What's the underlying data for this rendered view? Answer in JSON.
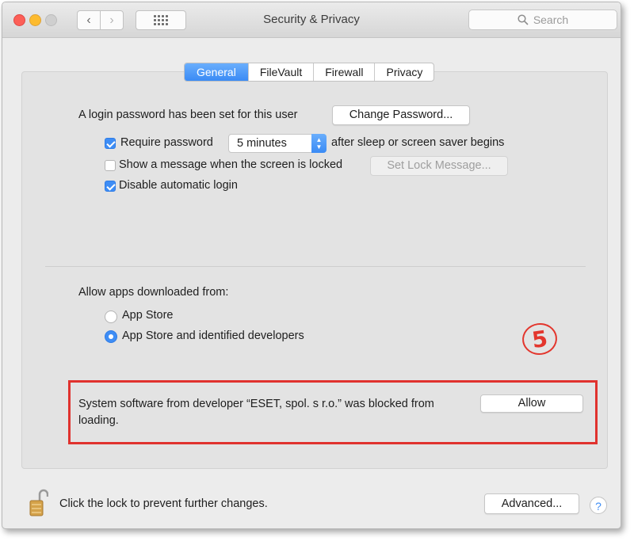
{
  "window": {
    "title": "Security & Privacy",
    "search_placeholder": "Search"
  },
  "tabs": [
    {
      "label": "General",
      "active": true
    },
    {
      "label": "FileVault",
      "active": false
    },
    {
      "label": "Firewall",
      "active": false
    },
    {
      "label": "Privacy",
      "active": false
    }
  ],
  "general": {
    "login_text": "A login password has been set for this user",
    "change_password_label": "Change Password...",
    "require_password": {
      "label": "Require password",
      "checked": true,
      "selected": "5 minutes",
      "suffix": "after sleep or screen saver begins"
    },
    "show_message": {
      "label": "Show a message when the screen is locked",
      "checked": false,
      "button_label": "Set Lock Message..."
    },
    "disable_autologin": {
      "label": "Disable automatic login",
      "checked": true
    }
  },
  "downloads": {
    "heading": "Allow apps downloaded from:",
    "options": [
      {
        "label": "App Store",
        "selected": false
      },
      {
        "label": "App Store and identified developers",
        "selected": true
      }
    ]
  },
  "blocked": {
    "message": "System software from developer “ESET, spol. s r.o.” was blocked from loading.",
    "allow_label": "Allow",
    "highlight_color": "#e0322e"
  },
  "annotation": {
    "step": "5",
    "color": "#e3362d"
  },
  "footer": {
    "lock_text": "Click the lock to prevent further changes.",
    "advanced_label": "Advanced...",
    "help_label": "?"
  },
  "colors": {
    "accent": "#3e8df5",
    "window_bg": "#ececec"
  }
}
